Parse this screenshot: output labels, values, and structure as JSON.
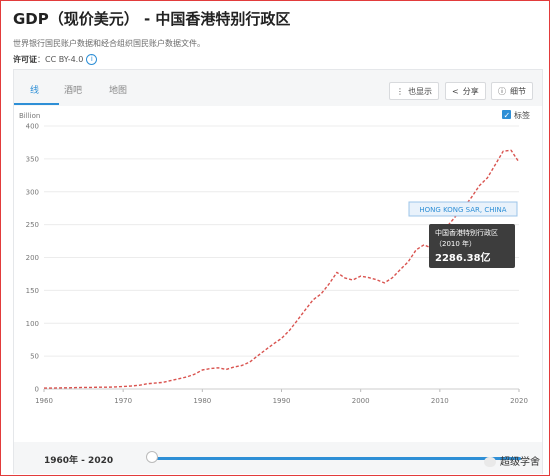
{
  "header": {
    "title": "GDP（现价美元） - 中国香港特别行政区",
    "description": "世界银行国民账户数据和经合组织国民账户数据文件。",
    "license_label": "许可证",
    "license_value": "：CC BY-4.0"
  },
  "tabs": [
    {
      "label": "线",
      "active": true
    },
    {
      "label": "酒吧",
      "active": false
    },
    {
      "label": "地图",
      "active": false
    }
  ],
  "toolbar": {
    "also_show": "也显示",
    "share": "分享",
    "details": "细节"
  },
  "label_checkbox": "标签",
  "tooltip": {
    "country_tag": "HONG KONG SAR, CHINA",
    "title": "中国香港特别行政区",
    "year": "（2010 年）",
    "value": "2286.38亿"
  },
  "footer": {
    "range": "1960年 - 2020"
  },
  "watermark": "超级学舍",
  "colors": {
    "line": "#d9534f",
    "accent": "#2e8fd6",
    "frame": "#e23b3b"
  },
  "chart_data": {
    "type": "line",
    "ylabel": "Billion",
    "xlim": [
      1960,
      2020
    ],
    "ylim": [
      0,
      400
    ],
    "yticks": [
      0,
      50,
      100,
      150,
      200,
      250,
      300,
      350,
      400
    ],
    "xticks": [
      1960,
      1970,
      1980,
      1990,
      2000,
      2010,
      2020
    ],
    "grid": true,
    "series": [
      {
        "name": "HONG KONG SAR, CHINA",
        "x": [
          1960,
          1961,
          1962,
          1963,
          1964,
          1965,
          1966,
          1967,
          1968,
          1969,
          1970,
          1971,
          1972,
          1973,
          1974,
          1975,
          1976,
          1977,
          1978,
          1979,
          1980,
          1981,
          1982,
          1983,
          1984,
          1985,
          1986,
          1987,
          1988,
          1989,
          1990,
          1991,
          1992,
          1993,
          1994,
          1995,
          1996,
          1997,
          1998,
          1999,
          2000,
          2001,
          2002,
          2003,
          2004,
          2005,
          2006,
          2007,
          2008,
          2009,
          2010,
          2011,
          2012,
          2013,
          2014,
          2015,
          2016,
          2017,
          2018,
          2019,
          2020
        ],
        "values": [
          1.3,
          1.4,
          1.6,
          1.8,
          2.1,
          2.4,
          2.5,
          2.7,
          2.7,
          3.2,
          3.8,
          4.5,
          5.7,
          7.9,
          9.0,
          10.0,
          12.7,
          15.5,
          18.3,
          22.3,
          28.9,
          31.1,
          32.3,
          29.7,
          33.5,
          35.7,
          41.1,
          50.6,
          59.7,
          68.8,
          76.9,
          88.9,
          104.3,
          120.4,
          135.8,
          144.7,
          159.7,
          177.4,
          168.9,
          165.8,
          171.7,
          169.4,
          166.3,
          161.4,
          169.1,
          181.6,
          193.5,
          211.6,
          219.3,
          214.0,
          228.6,
          248.5,
          262.6,
          275.7,
          291.5,
          309.4,
          320.9,
          341.3,
          361.7,
          363.1,
          344.9
        ]
      }
    ],
    "highlight": {
      "x": 2010,
      "y": 228.6
    }
  }
}
